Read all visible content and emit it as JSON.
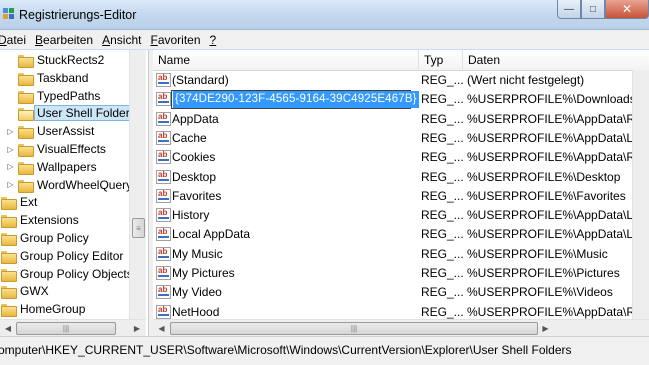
{
  "window": {
    "title": "Registrierungs-Editor",
    "buttons": {
      "minimize": "—",
      "maximize": "□",
      "close": "✕"
    }
  },
  "menu": [
    {
      "prefix": "",
      "ul": "D",
      "rest": "atei"
    },
    {
      "prefix": "",
      "ul": "B",
      "rest": "earbeiten"
    },
    {
      "prefix": "",
      "ul": "A",
      "rest": "nsicht"
    },
    {
      "prefix": "",
      "ul": "F",
      "rest": "avoriten"
    },
    {
      "prefix": "",
      "ul": "?",
      "rest": ""
    }
  ],
  "tree": [
    {
      "label": "StuckRects2",
      "level": 1,
      "expander": "",
      "selected": false,
      "open": false
    },
    {
      "label": "Taskband",
      "level": 1,
      "expander": "",
      "selected": false,
      "open": false
    },
    {
      "label": "TypedPaths",
      "level": 1,
      "expander": "",
      "selected": false,
      "open": false
    },
    {
      "label": "User Shell Folders",
      "level": 1,
      "expander": "",
      "selected": true,
      "open": true
    },
    {
      "label": "UserAssist",
      "level": 1,
      "expander": "▷",
      "selected": false,
      "open": false
    },
    {
      "label": "VisualEffects",
      "level": 1,
      "expander": "▷",
      "selected": false,
      "open": false
    },
    {
      "label": "Wallpapers",
      "level": 1,
      "expander": "▷",
      "selected": false,
      "open": false
    },
    {
      "label": "WordWheelQuery",
      "level": 1,
      "expander": "▷",
      "selected": false,
      "open": false
    },
    {
      "label": "Ext",
      "level": 0,
      "expander": "",
      "selected": false,
      "open": false
    },
    {
      "label": "Extensions",
      "level": 0,
      "expander": "",
      "selected": false,
      "open": false
    },
    {
      "label": "Group Policy",
      "level": 0,
      "expander": "",
      "selected": false,
      "open": false
    },
    {
      "label": "Group Policy Editor",
      "level": 0,
      "expander": "",
      "selected": false,
      "open": false
    },
    {
      "label": "Group Policy Objects",
      "level": 0,
      "expander": "",
      "selected": false,
      "open": false
    },
    {
      "label": "GWX",
      "level": 0,
      "expander": "",
      "selected": false,
      "open": false
    },
    {
      "label": "HomeGroup",
      "level": 0,
      "expander": "",
      "selected": false,
      "open": false
    }
  ],
  "columns": {
    "name": "Name",
    "type": "Typ",
    "data": "Daten"
  },
  "rows": [
    {
      "name": "(Standard)",
      "type": "REG_...",
      "data": "(Wert nicht festgelegt)",
      "editing": false
    },
    {
      "name": "{374DE290-123F-4565-9164-39C4925E467B}",
      "type": "REG_...",
      "data": "%USERPROFILE%\\Downloads",
      "editing": true
    },
    {
      "name": "AppData",
      "type": "REG_...",
      "data": "%USERPROFILE%\\AppData\\Roar",
      "editing": false
    },
    {
      "name": "Cache",
      "type": "REG_...",
      "data": "%USERPROFILE%\\AppData\\Local",
      "editing": false
    },
    {
      "name": "Cookies",
      "type": "REG_...",
      "data": "%USERPROFILE%\\AppData\\Roar",
      "editing": false
    },
    {
      "name": "Desktop",
      "type": "REG_...",
      "data": "%USERPROFILE%\\Desktop",
      "editing": false
    },
    {
      "name": "Favorites",
      "type": "REG_...",
      "data": "%USERPROFILE%\\Favorites",
      "editing": false
    },
    {
      "name": "History",
      "type": "REG_...",
      "data": "%USERPROFILE%\\AppData\\Local",
      "editing": false
    },
    {
      "name": "Local AppData",
      "type": "REG_...",
      "data": "%USERPROFILE%\\AppData\\Local",
      "editing": false
    },
    {
      "name": "My Music",
      "type": "REG_...",
      "data": "%USERPROFILE%\\Music",
      "editing": false
    },
    {
      "name": "My Pictures",
      "type": "REG_...",
      "data": "%USERPROFILE%\\Pictures",
      "editing": false
    },
    {
      "name": "My Video",
      "type": "REG_...",
      "data": "%USERPROFILE%\\Videos",
      "editing": false
    },
    {
      "name": "NetHood",
      "type": "REG_...",
      "data": "%USERPROFILE%\\AppData\\Roar",
      "editing": false
    }
  ],
  "status": "omputer\\HKEY_CURRENT_USER\\Software\\Microsoft\\Windows\\CurrentVersion\\Explorer\\User Shell Folders",
  "icons": {
    "value": "ab-icon",
    "folder": "folder-icon",
    "scroll_grip": "|||"
  },
  "colors": {
    "selection": "#3399ff",
    "tree_selection": "#cde6f7",
    "close_button": "#c9533b"
  }
}
